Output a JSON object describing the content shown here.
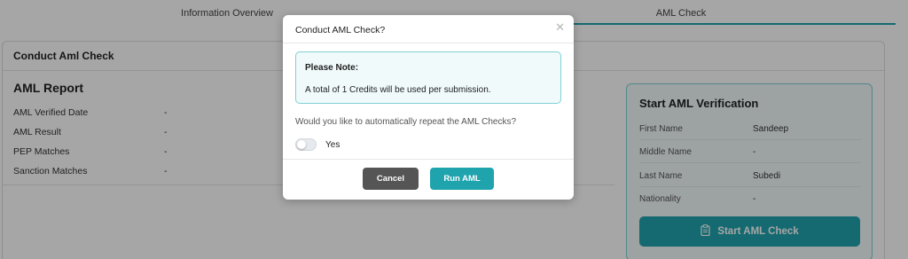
{
  "tabs": [
    {
      "label": "Information Overview"
    },
    {
      "label": "AML Check",
      "active": true
    }
  ],
  "card": {
    "title": "Conduct Aml Check"
  },
  "report": {
    "title": "AML Report",
    "rows": [
      {
        "label": "AML Verified Date",
        "value": "-"
      },
      {
        "label": "AML Result",
        "value": "-"
      },
      {
        "label": "PEP Matches",
        "value": "-"
      },
      {
        "label": "Sanction Matches",
        "value": "-"
      }
    ]
  },
  "verification": {
    "title": "Start AML Verification",
    "fields": [
      {
        "label": "First Name",
        "value": "Sandeep"
      },
      {
        "label": "Middle Name",
        "value": "-"
      },
      {
        "label": "Last Name",
        "value": "Subedi"
      },
      {
        "label": "Nationality",
        "value": "-"
      }
    ],
    "button_label": "Start AML Check",
    "button_icon": "clipboard-icon"
  },
  "modal": {
    "title": "Conduct AML Check?",
    "close_icon": "close-icon",
    "note_title": "Please Note:",
    "note_text": "A total of 1 Credits will be used per submission.",
    "question": "Would you like to automatically repeat the AML Checks?",
    "toggle_label": "Yes",
    "toggle_on": false,
    "cancel_label": "Cancel",
    "run_label": "Run AML"
  },
  "colors": {
    "accent": "#1fa3ad",
    "cancel": "#555555",
    "overlay": "rgba(0,0,0,0.35)"
  }
}
